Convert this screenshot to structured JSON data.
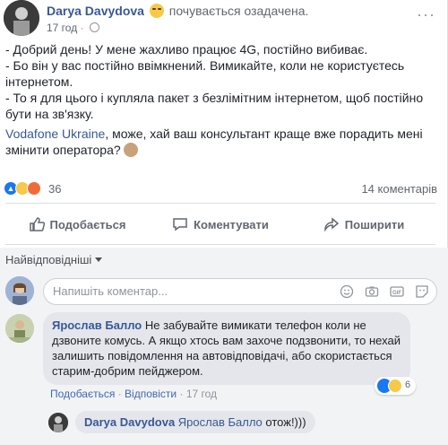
{
  "post": {
    "author": "Darya Davydova",
    "feeling": "почувається озадачена.",
    "time": "17 год",
    "more": "···",
    "lines": [
      "- Добрий день! У мене жахливо працює 4G, постійно вибиває.",
      "- Бо він у вас постійно ввімкнений. Вимикайте, коли не користуєтесь інтернетом.",
      "- То я для цього і купляла пакет з безлімітним інтернетом, щоб постійно бути на зв'язку."
    ],
    "mention": "Vodafone Ukraine",
    "mention_text": ", може, хай ваш консультант краще вже порадить мені змінити оператора?"
  },
  "reactions": {
    "count": "36",
    "comments": "14 коментарів"
  },
  "actions": {
    "like": "Подобається",
    "comment": "Коментувати",
    "share": "Поширити"
  },
  "comments": {
    "sort_label": "Найвідповідніші",
    "composer_placeholder": "Напишіть коментар...",
    "items": [
      {
        "author": "Ярослав Балло",
        "text": " Не забувайте вимикати телефон коли не дзвоните комусь. А якщо хтось вам захоче подзвонити, то нехай залишить повідомлення на автовідповідачі, або скористається старим-добрим пейджером.",
        "like": "Подобається",
        "reply": "Відповісти",
        "time": "17 год",
        "reaction_count": "6"
      }
    ],
    "reply": {
      "author": "Darya Davydova",
      "tag": "Ярослав Балло",
      "text": " отож!)))"
    }
  },
  "icons": [
    "globe-icon",
    "more-icon",
    "like-icon",
    "haha-icon",
    "angry-icon",
    "thumbs-up-icon",
    "comment-icon",
    "share-icon",
    "emoji-icon",
    "camera-icon",
    "gif-icon",
    "sticker-icon"
  ],
  "colors": {
    "link": "#385898",
    "like": "#1877f2",
    "haha": "#f7c948",
    "angry": "#f06b3b"
  }
}
